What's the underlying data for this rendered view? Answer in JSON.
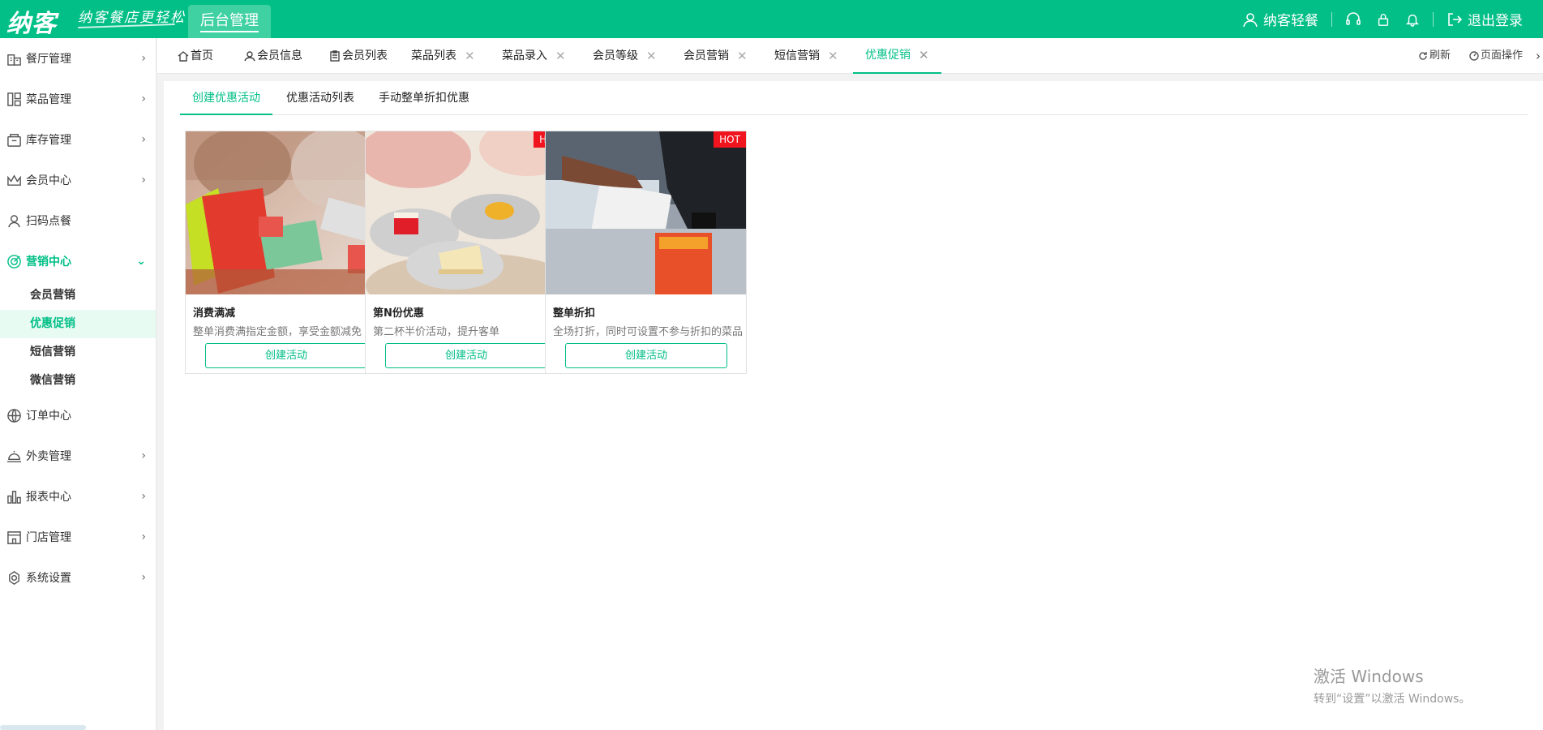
{
  "header": {
    "logo": "纳客",
    "slogan": "纳客餐店更轻松",
    "admin_tab": "后台管理",
    "user_name": "纳客轻餐",
    "logout": "退出登录",
    "brand_color": "#01bf86"
  },
  "sidebar": {
    "items": [
      {
        "label": "餐厅管理",
        "icon": "restaurant-icon"
      },
      {
        "label": "菜品管理",
        "icon": "dish-icon"
      },
      {
        "label": "库存管理",
        "icon": "inventory-icon"
      },
      {
        "label": "会员中心",
        "icon": "crown-icon"
      },
      {
        "label": "扫码点餐",
        "icon": "user-icon"
      },
      {
        "label": "营销中心",
        "icon": "target-icon"
      },
      {
        "label": "订单中心",
        "icon": "globe-icon"
      },
      {
        "label": "外卖管理",
        "icon": "cloche-icon"
      },
      {
        "label": "报表中心",
        "icon": "chart-icon"
      },
      {
        "label": "门店管理",
        "icon": "store-icon"
      },
      {
        "label": "系统设置",
        "icon": "settings-icon"
      }
    ],
    "subitems": [
      "会员营销",
      "优惠促销",
      "短信营销",
      "微信营销"
    ]
  },
  "tabs": {
    "items": [
      "首页",
      "会员信息",
      "会员列表",
      "菜品列表",
      "菜品录入",
      "会员等级",
      "会员营销",
      "短信营销",
      "优惠促销"
    ],
    "close": "✕",
    "refresh": "刷新",
    "page_ops": "页面操作"
  },
  "subtabs": [
    "创建优惠活动",
    "优惠活动列表",
    "手动整单折扣优惠"
  ],
  "cards": [
    {
      "title": "消费满减",
      "desc": "整单消费满指定金额，享受金额减免",
      "button": "创建活动",
      "badge": ""
    },
    {
      "title": "第N份优惠",
      "desc": "第二杯半价活动，提升客单",
      "button": "创建活动",
      "badge": "HOT"
    },
    {
      "title": "整单折扣",
      "desc": "全场打折，同时可设置不参与折扣的菜品",
      "button": "创建活动",
      "badge": "HOT"
    }
  ],
  "watermark": {
    "line1": "激活 Windows",
    "line2": "转到“设置”以激活 Windows。"
  }
}
